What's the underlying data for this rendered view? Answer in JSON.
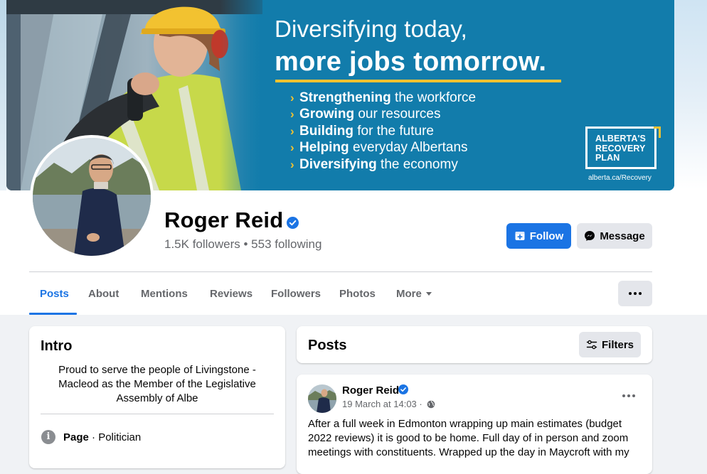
{
  "cover": {
    "headline_line1": "Diversifying today,",
    "headline_line2": "more jobs tomorrow.",
    "bullets": [
      {
        "bold": "Strengthening",
        "rest": " the workforce"
      },
      {
        "bold": "Growing",
        "rest": " our resources"
      },
      {
        "bold": "Building",
        "rest": " for the future"
      },
      {
        "bold": "Helping",
        "rest": " everyday Albertans"
      },
      {
        "bold": "Diversifying",
        "rest": " the economy"
      }
    ],
    "logo_lines": [
      "ALBERTA'S",
      "RECOVERY",
      "PLAN"
    ],
    "logo_url": "alberta.ca/Recovery",
    "colors": {
      "banner": "#127cab",
      "accent": "#f2c230"
    }
  },
  "profile": {
    "name": "Roger Reid",
    "stats": "1.5K followers • 553 following",
    "follow_label": "Follow",
    "message_label": "Message"
  },
  "tabs": [
    {
      "label": "Posts",
      "active": true
    },
    {
      "label": "About"
    },
    {
      "label": "Mentions"
    },
    {
      "label": "Reviews"
    },
    {
      "label": "Followers"
    },
    {
      "label": "Photos"
    },
    {
      "label": "More"
    }
  ],
  "intro": {
    "title": "Intro",
    "bio": "Proud to serve the people of Livingstone - Macleod as the Member of the Legislative Assembly of Albe",
    "page_label": "Page",
    "page_category": " · Politician"
  },
  "posts_section": {
    "title": "Posts",
    "filters_label": "Filters"
  },
  "post": {
    "author": "Roger Reid",
    "timestamp": "19 March at 14:03 ·",
    "text": "After a full week in Edmonton wrapping up main estimates (budget 2022 reviews) it is good to be home. Full day of in person and zoom meetings with constituents. Wrapped up the day in Maycroft with my"
  },
  "colors": {
    "brand_blue": "#1b74e4",
    "page_bg": "#f0f2f5",
    "secondary_text": "#65676b"
  }
}
